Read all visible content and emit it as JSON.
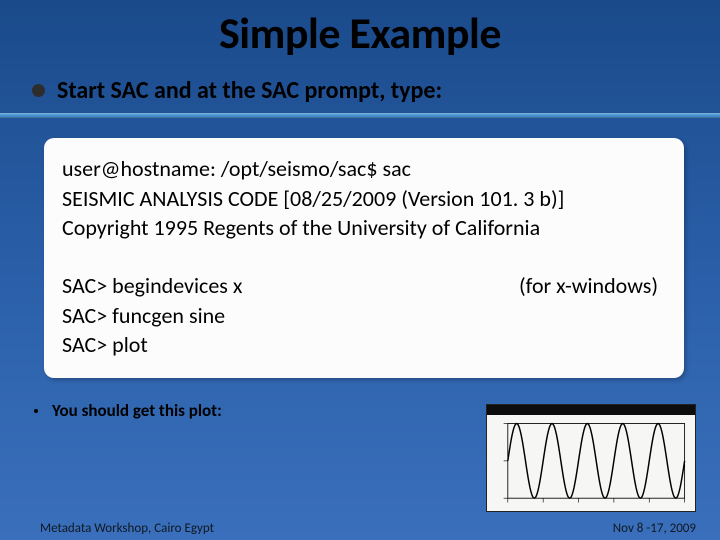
{
  "title": "Simple Example",
  "bullet": "Start SAC and at the SAC prompt, type:",
  "terminal": {
    "prompt_line": "user@hostname: /opt/seismo/sac$ sac",
    "banner_line1": "SEISMIC ANALYSIS CODE [08/25/2009 (Version 101. 3 b)]",
    "banner_line2": "Copyright 1995 Regents of the University of California",
    "cmd1": "SAC> begindevices x",
    "cmd2": "SAC> funcgen sine",
    "cmd3": "SAC> plot",
    "annotation": "(for x-windows)"
  },
  "sub_bullet": "You should get this plot:",
  "footer_left": "Metadata Workshop, Cairo Egypt",
  "footer_right": "Nov 8 -17, 2009",
  "chart_data": {
    "type": "line",
    "title": "",
    "xlabel": "",
    "ylabel": "",
    "xlim": [
      0,
      100
    ],
    "ylim": [
      -1,
      1
    ],
    "series": [
      {
        "name": "sine",
        "function": "sin(2*pi*x/20)",
        "x_range": [
          0,
          100
        ],
        "samples": 201
      }
    ]
  }
}
